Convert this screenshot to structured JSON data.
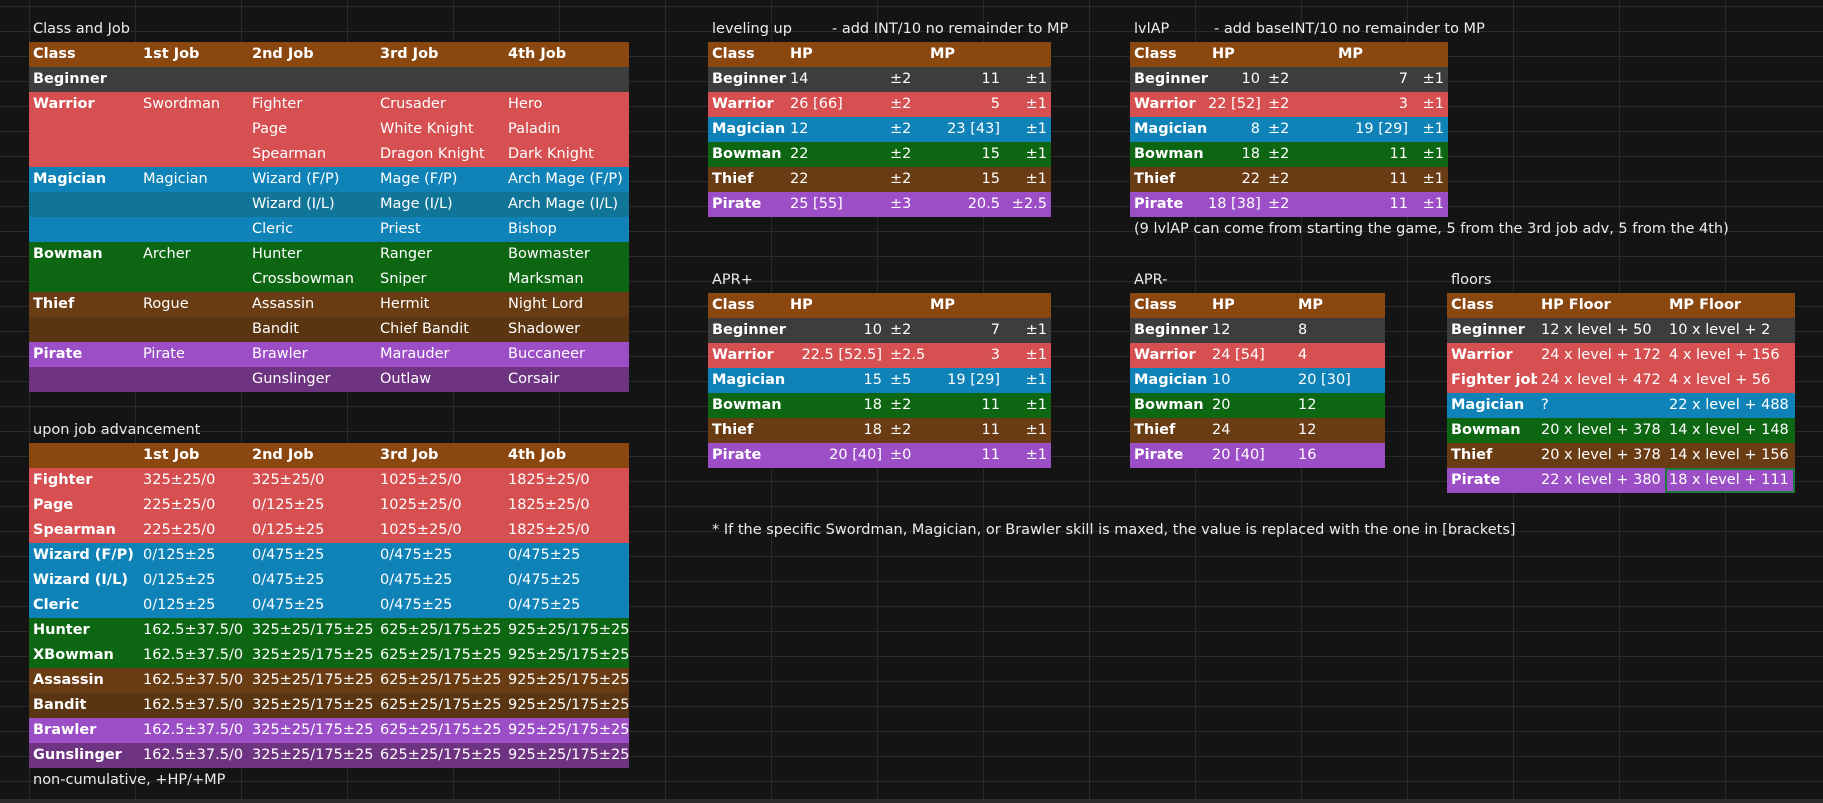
{
  "class_job": {
    "title": "Class and Job",
    "headers": [
      "Class",
      "1st Job",
      "2nd Job",
      "3rd Job",
      "4th Job"
    ],
    "rows": [
      {
        "style": "beg",
        "cells": [
          "Beginner",
          "",
          "",
          "",
          ""
        ]
      },
      {
        "style": "war",
        "cells": [
          "Warrior",
          "Swordman",
          "Fighter",
          "Crusader",
          "Hero"
        ]
      },
      {
        "style": "war",
        "cells": [
          "",
          "",
          "Page",
          "White Knight",
          "Paladin"
        ]
      },
      {
        "style": "war",
        "cells": [
          "",
          "",
          "Spearman",
          "Dragon Knight",
          "Dark Knight"
        ]
      },
      {
        "style": "mag",
        "cells": [
          "Magician",
          "Magician",
          "Wizard (F/P)",
          "Mage (F/P)",
          "Arch Mage (F/P)"
        ]
      },
      {
        "style": "mag2",
        "cells": [
          "",
          "",
          "Wizard (I/L)",
          "Mage (I/L)",
          "Arch Mage (I/L)"
        ]
      },
      {
        "style": "mag",
        "cells": [
          "",
          "",
          "Cleric",
          "Priest",
          "Bishop"
        ]
      },
      {
        "style": "bow",
        "cells": [
          "Bowman",
          "Archer",
          "Hunter",
          "Ranger",
          "Bowmaster"
        ]
      },
      {
        "style": "bow",
        "cells": [
          "",
          "",
          "Crossbowman",
          "Sniper",
          "Marksman"
        ]
      },
      {
        "style": "thi",
        "cells": [
          "Thief",
          "Rogue",
          "Assassin",
          "Hermit",
          "Night Lord"
        ]
      },
      {
        "style": "thi2",
        "cells": [
          "",
          "",
          "Bandit",
          "Chief Bandit",
          "Shadower"
        ]
      },
      {
        "style": "pir",
        "cells": [
          "Pirate",
          "Pirate",
          "Brawler",
          "Marauder",
          "Buccaneer"
        ]
      },
      {
        "style": "pir2",
        "cells": [
          "",
          "",
          "Gunslinger",
          "Outlaw",
          "Corsair"
        ]
      }
    ]
  },
  "job_adv": {
    "title": "upon job advancement",
    "headers": [
      "",
      "1st Job",
      "2nd Job",
      "3rd Job",
      "4th Job"
    ],
    "rows": [
      {
        "style": "war",
        "cells": [
          "Fighter",
          "325±25/0",
          "325±25/0",
          "1025±25/0",
          "1825±25/0"
        ]
      },
      {
        "style": "war",
        "cells": [
          "Page",
          "225±25/0",
          "0/125±25",
          "1025±25/0",
          "1825±25/0"
        ]
      },
      {
        "style": "war",
        "cells": [
          "Spearman",
          "225±25/0",
          "0/125±25",
          "1025±25/0",
          "1825±25/0"
        ]
      },
      {
        "style": "mag",
        "cells": [
          "Wizard (F/P)",
          "0/125±25",
          "0/475±25",
          "0/475±25",
          "0/475±25"
        ]
      },
      {
        "style": "mag",
        "cells": [
          "Wizard (I/L)",
          "0/125±25",
          "0/475±25",
          "0/475±25",
          "0/475±25"
        ]
      },
      {
        "style": "mag",
        "cells": [
          "Cleric",
          "0/125±25",
          "0/475±25",
          "0/475±25",
          "0/475±25"
        ]
      },
      {
        "style": "bow",
        "cells": [
          "Hunter",
          "162.5±37.5/0",
          "325±25/175±25",
          "625±25/175±25",
          "925±25/175±25"
        ]
      },
      {
        "style": "bow",
        "cells": [
          "XBowman",
          "162.5±37.5/0",
          "325±25/175±25",
          "625±25/175±25",
          "925±25/175±25"
        ]
      },
      {
        "style": "thi",
        "cells": [
          "Assassin",
          "162.5±37.5/0",
          "325±25/175±25",
          "625±25/175±25",
          "925±25/175±25"
        ]
      },
      {
        "style": "thi2",
        "cells": [
          "Bandit",
          "162.5±37.5/0",
          "325±25/175±25",
          "625±25/175±25",
          "925±25/175±25"
        ]
      },
      {
        "style": "pir",
        "cells": [
          "Brawler",
          "162.5±37.5/0",
          "325±25/175±25",
          "625±25/175±25",
          "925±25/175±25"
        ]
      },
      {
        "style": "pir2",
        "cells": [
          "Gunslinger",
          "162.5±37.5/0",
          "325±25/175±25",
          "625±25/175±25",
          "925±25/175±25"
        ]
      }
    ],
    "footnote": "non-cumulative, +HP/+MP"
  },
  "leveling_up": {
    "title": "leveling up",
    "note": "- add INT/10 no remainder to MP",
    "headers": [
      "Class",
      "HP",
      "",
      "MP",
      ""
    ],
    "rows": [
      {
        "style": "beg",
        "cells": [
          "Beginner",
          "14",
          "±2",
          "11",
          "±1"
        ]
      },
      {
        "style": "war",
        "cells": [
          "Warrior",
          "26 [66]",
          "±2",
          "5",
          "±1"
        ]
      },
      {
        "style": "mag",
        "cells": [
          "Magician",
          "12",
          "±2",
          "23 [43]",
          "±1"
        ]
      },
      {
        "style": "bow",
        "cells": [
          "Bowman",
          "22",
          "±2",
          "15",
          "±1"
        ]
      },
      {
        "style": "thi",
        "cells": [
          "Thief",
          "22",
          "±2",
          "15",
          "±1"
        ]
      },
      {
        "style": "pir",
        "cells": [
          "Pirate",
          "25 [55]",
          "±3",
          "20.5",
          "±2.5"
        ]
      }
    ]
  },
  "lvlap": {
    "title": "lvlAP",
    "note": "- add baseINT/10 no remainder to MP",
    "headers": [
      "Class",
      "HP",
      "",
      "MP",
      ""
    ],
    "rows": [
      {
        "style": "beg",
        "cells": [
          "Beginner",
          "10",
          "±2",
          "7",
          "±1"
        ]
      },
      {
        "style": "war",
        "cells": [
          "Warrior",
          "22 [52]",
          "±2",
          "3",
          "±1"
        ]
      },
      {
        "style": "mag",
        "cells": [
          "Magician",
          "8",
          "±2",
          "19 [29]",
          "±1"
        ]
      },
      {
        "style": "bow",
        "cells": [
          "Bowman",
          "18",
          "±2",
          "11",
          "±1"
        ]
      },
      {
        "style": "thi",
        "cells": [
          "Thief",
          "22",
          "±2",
          "11",
          "±1"
        ]
      },
      {
        "style": "pir",
        "cells": [
          "Pirate",
          "18 [38]",
          "±2",
          "11",
          "±1"
        ]
      }
    ],
    "footnote": "(9 lvlAP can come from starting the game, 5 from the 3rd job adv, 5 from the 4th)"
  },
  "apr_plus": {
    "title": "APR+",
    "headers": [
      "Class",
      "HP",
      "",
      "MP",
      ""
    ],
    "rows": [
      {
        "style": "beg",
        "cells": [
          "Beginner",
          "10",
          "±2",
          "7",
          "±1"
        ]
      },
      {
        "style": "war",
        "cells": [
          "Warrior",
          "22.5 [52.5]",
          "±2.5",
          "3",
          "±1"
        ]
      },
      {
        "style": "mag",
        "cells": [
          "Magician",
          "15",
          "±5",
          "19 [29]",
          "±1"
        ]
      },
      {
        "style": "bow",
        "cells": [
          "Bowman",
          "18",
          "±2",
          "11",
          "±1"
        ]
      },
      {
        "style": "thi",
        "cells": [
          "Thief",
          "18",
          "±2",
          "11",
          "±1"
        ]
      },
      {
        "style": "pir",
        "cells": [
          "Pirate",
          "20 [40]",
          "±0",
          "11",
          "±1"
        ]
      }
    ]
  },
  "apr_minus": {
    "title": "APR-",
    "headers": [
      "Class",
      "HP",
      "MP"
    ],
    "rows": [
      {
        "style": "beg",
        "cells": [
          "Beginner",
          "12",
          "8"
        ]
      },
      {
        "style": "war",
        "cells": [
          "Warrior",
          "24 [54]",
          "4"
        ]
      },
      {
        "style": "mag",
        "cells": [
          "Magician",
          "10",
          "20 [30]"
        ]
      },
      {
        "style": "bow",
        "cells": [
          "Bowman",
          "20",
          "12"
        ]
      },
      {
        "style": "thi",
        "cells": [
          "Thief",
          "24",
          "12"
        ]
      },
      {
        "style": "pir",
        "cells": [
          "Pirate",
          "20 [40]",
          "16"
        ]
      }
    ]
  },
  "floors": {
    "title": "floors",
    "headers": [
      "Class",
      "HP Floor",
      "MP Floor"
    ],
    "rows": [
      {
        "style": "beg",
        "cells": [
          "Beginner",
          "12 x level + 50",
          "10 x level + 2"
        ]
      },
      {
        "style": "war",
        "cells": [
          "Warrior",
          "24 x level + 172",
          "4 x level + 156"
        ]
      },
      {
        "style": "war",
        "cells": [
          "Fighter job",
          "24 x level + 472",
          "4 x level + 56"
        ]
      },
      {
        "style": "mag",
        "cells": [
          "Magician",
          "?",
          "22 x level + 488"
        ]
      },
      {
        "style": "bow",
        "cells": [
          "Bowman",
          "20 x level + 378",
          "14 x level + 148"
        ]
      },
      {
        "style": "thi",
        "cells": [
          "Thief",
          "20 x level + 378",
          "14 x level + 156"
        ]
      },
      {
        "style": "pir",
        "cells": [
          "Pirate",
          "22 x level + 380",
          "18 x level + 111"
        ]
      }
    ]
  },
  "bracket_note": "* If the specific Swordman, Magician, or Brawler skill is maxed, the value is replaced with the one in [brackets]",
  "colors": {
    "header": "#8b4710",
    "beginner": "#3d3d3d",
    "warrior": "#d65052",
    "magician": "#0f83b7",
    "bowman": "#0d6712",
    "thief": "#6a3c13",
    "pirate": "#9c4ec6"
  }
}
